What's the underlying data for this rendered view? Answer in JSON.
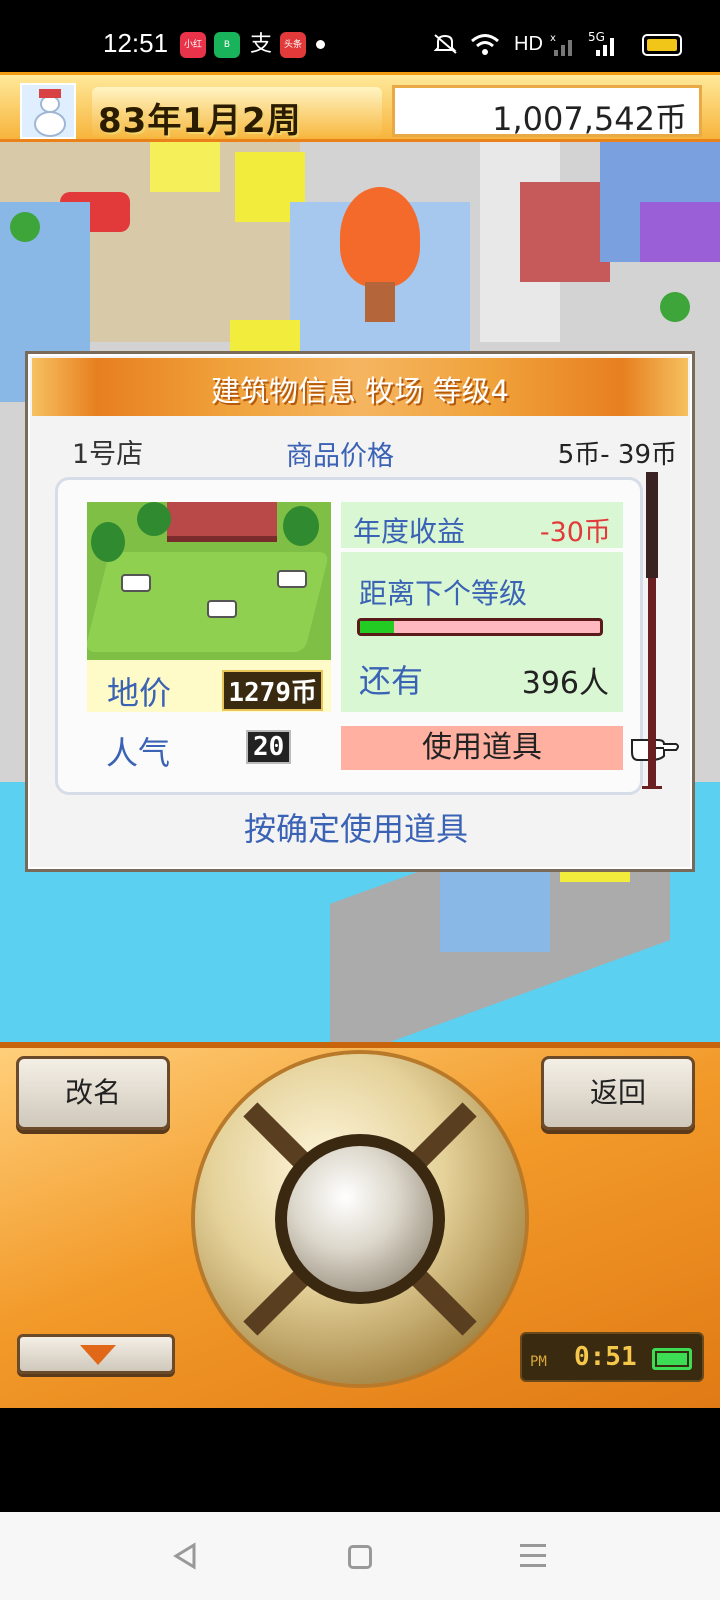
{
  "status_bar": {
    "time": "12:51",
    "apps": [
      "小红书",
      "B",
      "支",
      "头条"
    ],
    "network_label": "HD",
    "signal_label": "5G"
  },
  "game_header": {
    "date": "83年1月2周",
    "money": "1,007,542币"
  },
  "dialog": {
    "title": "建筑物信息 牧场 等级4",
    "shop_name": "1号店",
    "price_label": "商品价格",
    "price_range": "5币- 39币",
    "land_label": "地价",
    "land_value": "1279币",
    "popularity_label": "人气",
    "popularity_value": "20",
    "revenue_label": "年度收益",
    "revenue_value": "-30币",
    "next_level_label": "距离下个等级",
    "next_level_progress": 0.14,
    "remaining_label": "还有",
    "remaining_value": "396人",
    "use_item_label": "使用道具",
    "hint": "按确定使用道具",
    "colors": {
      "label_blue": "#3a62b5",
      "negative_red": "#e23a3a",
      "progress_green": "#22cc22",
      "title_orange": "#e77f1f"
    }
  },
  "controller": {
    "rename_label": "改名",
    "back_label": "返回",
    "clock_period": "PM",
    "clock_time": "0:51"
  },
  "nav": {
    "icons": [
      "back-triangle-icon",
      "home-square-icon",
      "menu-lines-icon"
    ]
  }
}
